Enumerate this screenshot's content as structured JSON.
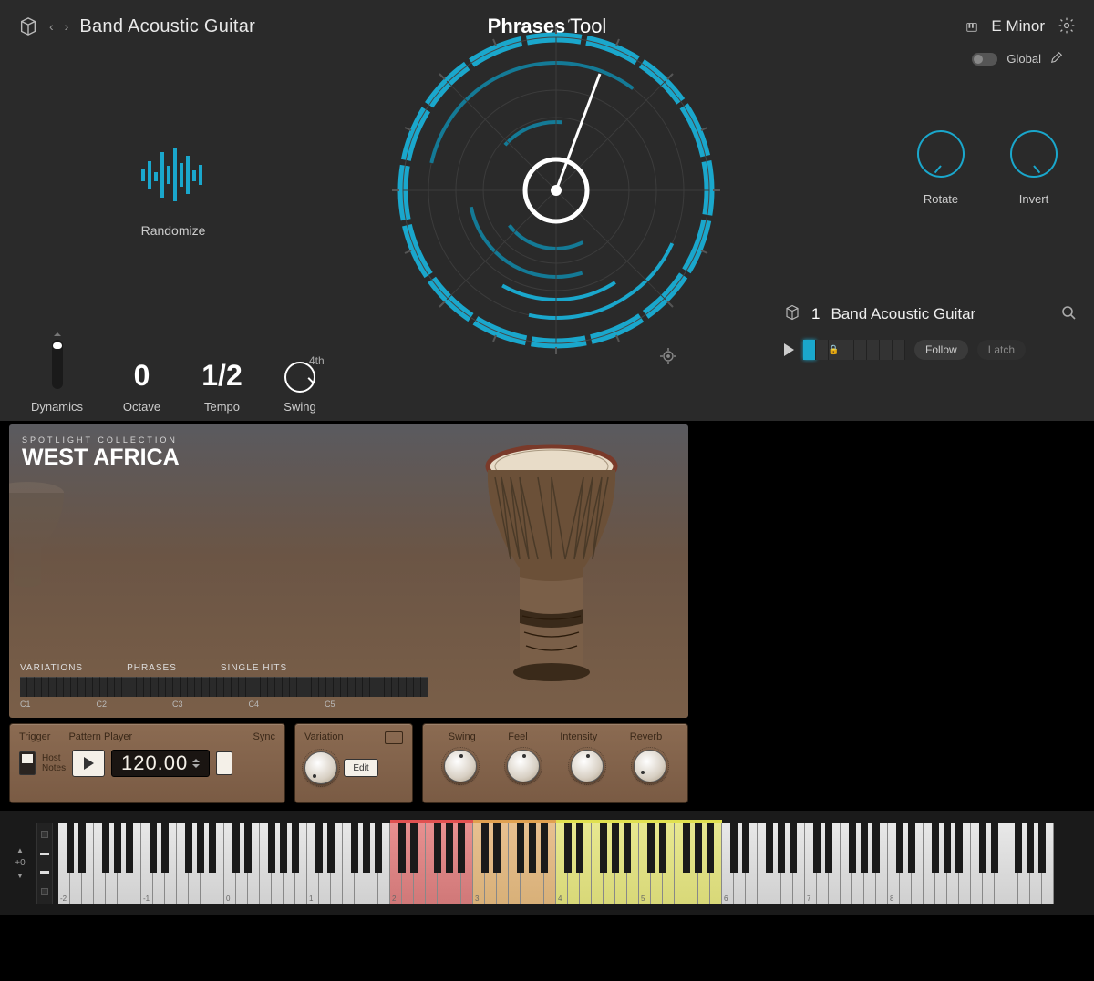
{
  "header": {
    "preset_name": "Band Acoustic Guitar",
    "title_main": "Phrases",
    "title_sub": "Tool",
    "key": "E Minor"
  },
  "randomize": {
    "label": "Randomize"
  },
  "controls": {
    "dynamics": {
      "label": "Dynamics"
    },
    "octave": {
      "label": "Octave",
      "value": "0"
    },
    "tempo": {
      "label": "Tempo",
      "value": "1/2"
    },
    "swing": {
      "label": "Swing",
      "sup": "4th"
    }
  },
  "right": {
    "global_label": "Global",
    "rotate_label": "Rotate",
    "invert_label": "Invert",
    "slot_num": "1",
    "slot_name": "Band Acoustic Guitar",
    "follow": "Follow",
    "latch": "Latch"
  },
  "instrument": {
    "subtitle": "SPOTLIGHT COLLECTION",
    "name": "WEST AFRICA",
    "zones": [
      "VARIATIONS",
      "PHRASES",
      "SINGLE HITS"
    ],
    "octaves": [
      "C1",
      "C2",
      "C3",
      "C4",
      "C5"
    ],
    "panel_a": {
      "trigger": "Trigger",
      "pattern_player": "Pattern Player",
      "sync": "Sync",
      "host_notes": "Host\nNotes",
      "bpm": "120.00"
    },
    "panel_b": {
      "variation": "Variation",
      "edit": "Edit"
    },
    "panel_c": {
      "swing": "Swing",
      "feel": "Feel",
      "intensity": "Intensity",
      "reverb": "Reverb"
    }
  },
  "keyboard": {
    "pitch_label": "+0",
    "octave_labels": [
      "-2",
      "-1",
      "0",
      "1",
      "2",
      "3",
      "4",
      "5",
      "6",
      "7",
      "8"
    ]
  }
}
